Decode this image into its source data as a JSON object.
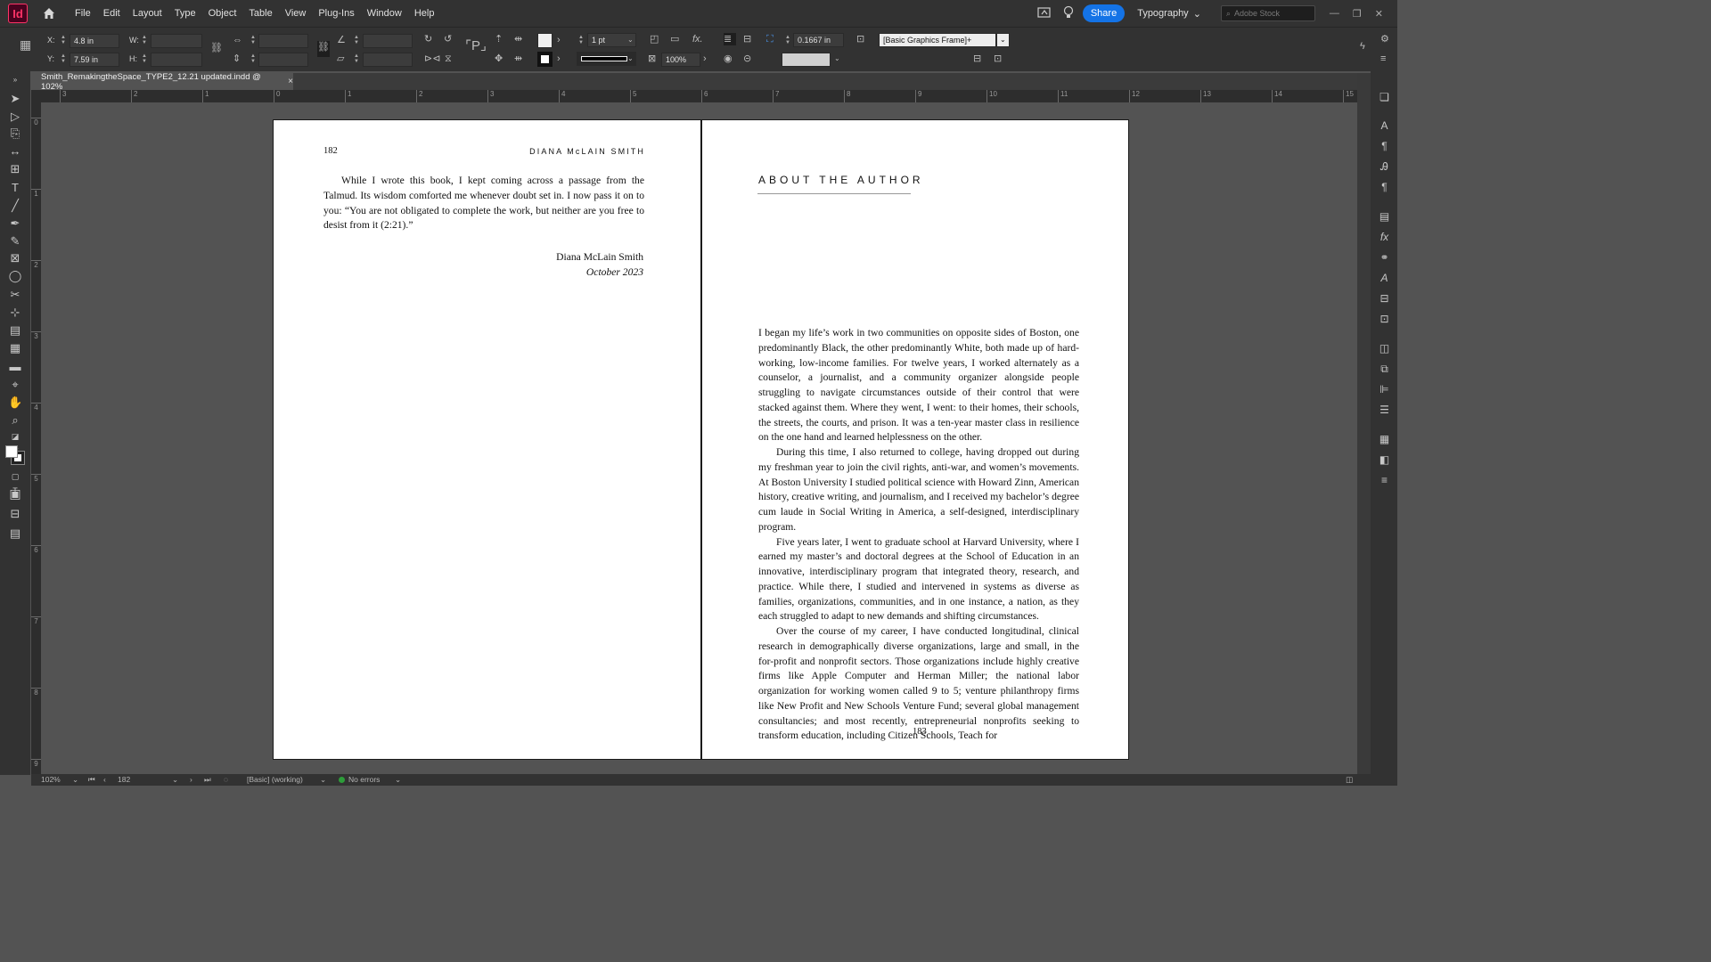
{
  "app": {
    "logo": "Id",
    "menu": [
      "File",
      "Edit",
      "Layout",
      "Type",
      "Object",
      "Table",
      "View",
      "Plug-Ins",
      "Window",
      "Help"
    ],
    "share_label": "Share",
    "workspace": "Typography",
    "stock_placeholder": "Adobe Stock"
  },
  "control": {
    "x_label": "X:",
    "x_value": "4.8 in",
    "y_label": "Y:",
    "y_value": "7.59 in",
    "w_label": "W:",
    "h_label": "H:",
    "stroke_weight": "1 pt",
    "opacity": "100%",
    "offset": "0.1667 in",
    "object_style": "[Basic Graphics Frame]+",
    "fx_label": "fx."
  },
  "tab": {
    "title": "Smith_RemakingtheSpace_TYPE2_12.21 updated.indd @ 102%",
    "close": "×"
  },
  "ruler": {
    "h_ticks": [
      "3",
      "2",
      "1",
      "0",
      "1",
      "2",
      "3",
      "4",
      "5",
      "6",
      "7",
      "8",
      "9",
      "10",
      "11",
      "12",
      "13",
      "14",
      "15"
    ],
    "v_ticks": [
      "0",
      "1",
      "2",
      "3",
      "4",
      "5",
      "6",
      "7",
      "8",
      "9"
    ]
  },
  "left_page": {
    "folio": "182",
    "running_head": "DIANA McLAIN SMITH",
    "paragraph": "While I wrote this book, I kept coming across a passage from the Talmud. Its wisdom comforted me whenever doubt set in. I now pass it on to you: “You are not obligated to complete the work, but neither are you free to desist from it (2:21).”",
    "signature_name": "Diana McLain Smith",
    "signature_date": "October 2023"
  },
  "right_page": {
    "heading": "ABOUT THE AUTHOR",
    "folio": "183",
    "paragraphs": [
      "I began my life’s work in two communities on opposite sides of Boston, one predominantly Black, the other predominantly White, both made up of hard-working, low-income families. For twelve years, I worked alternately as a counselor, a journalist, and a community organizer alongside people struggling to navigate circumstances outside of their control that were stacked against them. Where they went, I went: to their homes, their schools, the streets, the courts, and prison. It was a ten-year master class in resilience on the one hand and learned helplessness on the other.",
      "During this time, I also returned to college, having dropped out during my freshman year to join the civil rights, anti-war, and women’s movements. At Boston University I studied political science with Howard Zinn, American history, creative writing, and journalism, and I received my bachelor’s degree cum laude in Social Writing in America, a self-designed, interdisciplinary program.",
      "Five years later, I went to graduate school at Harvard University, where I earned my master’s and doctoral degrees at the School of Education in an innovative, interdisciplinary program that integrated theory, research, and practice. While there, I studied and intervened in systems as diverse as families, organizations, communities, and in one instance, a nation, as they each struggled to adapt to new demands and shifting circumstances.",
      "Over the course of my career, I have conducted longitudinal, clinical research in demographically diverse organizations, large and small, in the for-profit and nonprofit sectors. Those organizations include highly creative firms like Apple Computer and Herman Miller; the national labor organization for working women called 9 to 5; venture philanthropy firms like New Profit and New Schools Venture Fund; several global management consultancies; and most recently, entrepreneurial nonprofits seeking to transform education, including Citizen Schools, Teach for"
    ]
  },
  "status": {
    "zoom": "102%",
    "page": "182",
    "profile": "[Basic] (working)",
    "errors": "No errors"
  },
  "colors": {
    "accent": "#1473e6",
    "app_brand": "#ff3366",
    "ok": "#2d9d3a"
  }
}
